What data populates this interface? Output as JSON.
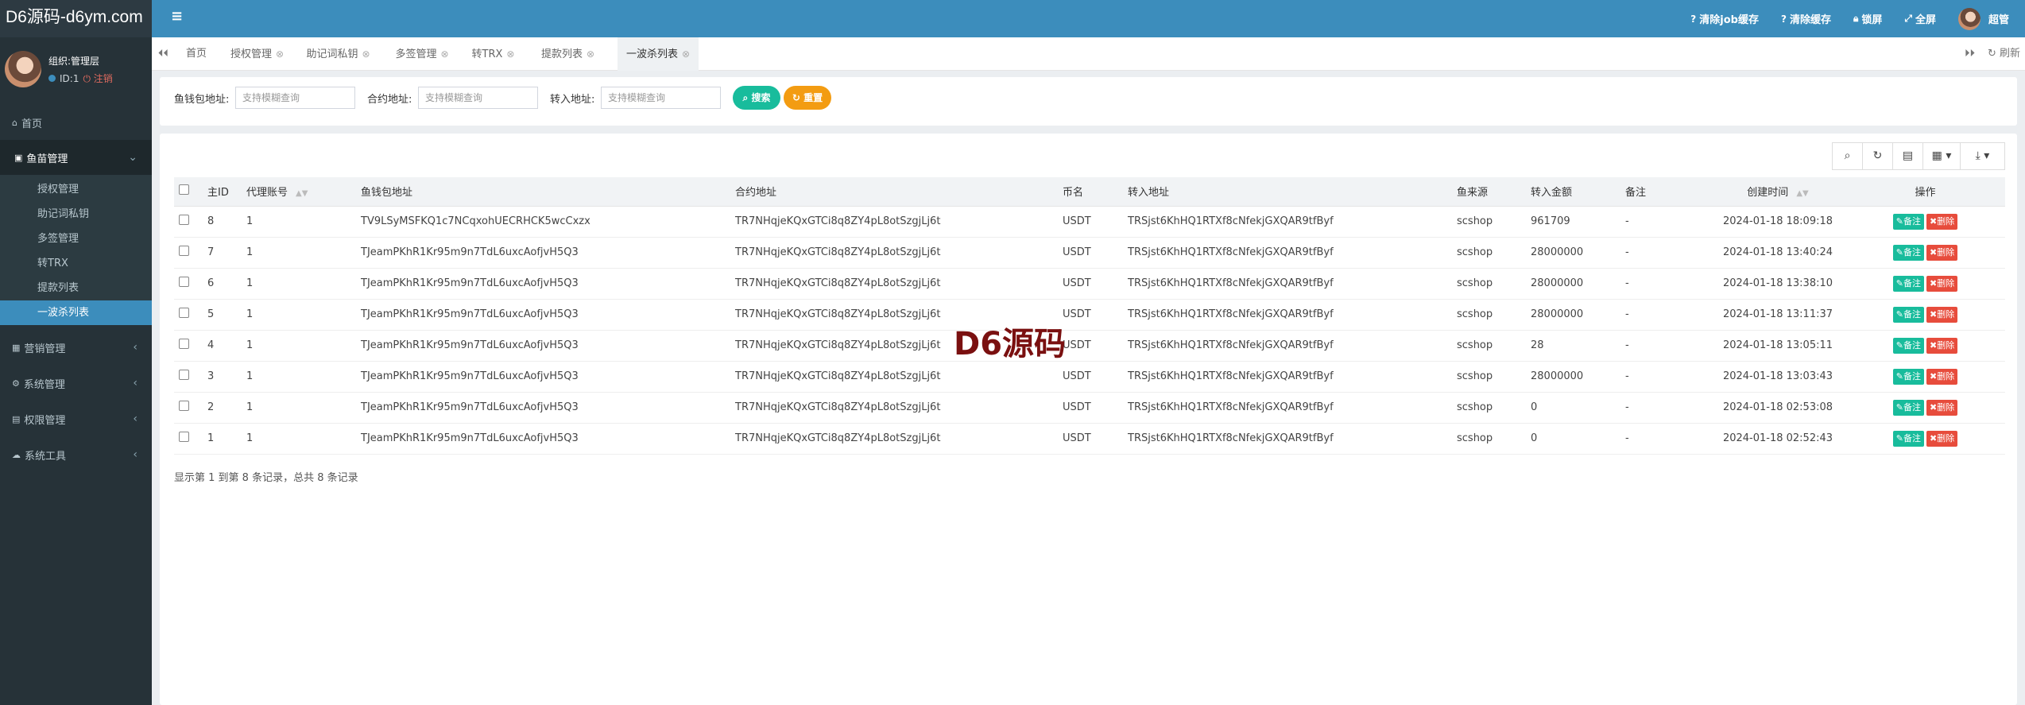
{
  "logo": "D6源码-d6ym.com",
  "user": {
    "name": "组织:管理层",
    "id": "ID:1",
    "logout": "注销"
  },
  "menu": {
    "home": "首页",
    "fish": "鱼苗管理",
    "sub": [
      "授权管理",
      "助记词私钥",
      "多签管理",
      "转TRX",
      "提款列表",
      "一波杀列表"
    ],
    "others": [
      "营销管理",
      "系统管理",
      "权限管理",
      "系统工具"
    ]
  },
  "topbar": {
    "clear_job": "清除job缓存",
    "clear_cache": "清除缓存",
    "lock": "锁屏",
    "fullscreen": "全屏",
    "admin": "超管"
  },
  "tabs": {
    "items": [
      "首页",
      "授权管理",
      "助记词私钥",
      "多签管理",
      "转TRX",
      "提款列表",
      "一波杀列表"
    ],
    "refresh": "刷新"
  },
  "search": {
    "f1_label": "鱼钱包地址:",
    "f1_placeholder": "支持模糊查询",
    "f2_label": "合约地址:",
    "f2_placeholder": "支持模糊查询",
    "f3_label": "转入地址:",
    "f3_placeholder": "支持模糊查询",
    "search_btn": "搜索",
    "reset_btn": "重置"
  },
  "table": {
    "headers": [
      "主ID",
      "代理账号",
      "鱼钱包地址",
      "合约地址",
      "币名",
      "转入地址",
      "鱼来源",
      "转入金额",
      "备注",
      "创建时间",
      "操作"
    ],
    "action_edit": "备注",
    "action_delete": "删除",
    "rows": [
      [
        "8",
        "1",
        "TV9LSyMSFKQ1c7NCqxohUECRHCK5wcCxzx",
        "TR7NHqjeKQxGTCi8q8ZY4pL8otSzgjLj6t",
        "USDT",
        "TRSjst6KhHQ1RTXf8cNfekjGXQAR9tfByf",
        "scshop",
        "961709",
        "-",
        "2024-01-18 18:09:18"
      ],
      [
        "7",
        "1",
        "TJeamPKhR1Kr95m9n7TdL6uxcAofjvH5Q3",
        "TR7NHqjeKQxGTCi8q8ZY4pL8otSzgjLj6t",
        "USDT",
        "TRSjst6KhHQ1RTXf8cNfekjGXQAR9tfByf",
        "scshop",
        "28000000",
        "-",
        "2024-01-18 13:40:24"
      ],
      [
        "6",
        "1",
        "TJeamPKhR1Kr95m9n7TdL6uxcAofjvH5Q3",
        "TR7NHqjeKQxGTCi8q8ZY4pL8otSzgjLj6t",
        "USDT",
        "TRSjst6KhHQ1RTXf8cNfekjGXQAR9tfByf",
        "scshop",
        "28000000",
        "-",
        "2024-01-18 13:38:10"
      ],
      [
        "5",
        "1",
        "TJeamPKhR1Kr95m9n7TdL6uxcAofjvH5Q3",
        "TR7NHqjeKQxGTCi8q8ZY4pL8otSzgjLj6t",
        "USDT",
        "TRSjst6KhHQ1RTXf8cNfekjGXQAR9tfByf",
        "scshop",
        "28000000",
        "-",
        "2024-01-18 13:11:37"
      ],
      [
        "4",
        "1",
        "TJeamPKhR1Kr95m9n7TdL6uxcAofjvH5Q3",
        "TR7NHqjeKQxGTCi8q8ZY4pL8otSzgjLj6t",
        "USDT",
        "TRSjst6KhHQ1RTXf8cNfekjGXQAR9tfByf",
        "scshop",
        "28",
        "-",
        "2024-01-18 13:05:11"
      ],
      [
        "3",
        "1",
        "TJeamPKhR1Kr95m9n7TdL6uxcAofjvH5Q3",
        "TR7NHqjeKQxGTCi8q8ZY4pL8otSzgjLj6t",
        "USDT",
        "TRSjst6KhHQ1RTXf8cNfekjGXQAR9tfByf",
        "scshop",
        "28000000",
        "-",
        "2024-01-18 13:03:43"
      ],
      [
        "2",
        "1",
        "TJeamPKhR1Kr95m9n7TdL6uxcAofjvH5Q3",
        "TR7NHqjeKQxGTCi8q8ZY4pL8otSzgjLj6t",
        "USDT",
        "TRSjst6KhHQ1RTXf8cNfekjGXQAR9tfByf",
        "scshop",
        "0",
        "-",
        "2024-01-18 02:53:08"
      ],
      [
        "1",
        "1",
        "TJeamPKhR1Kr95m9n7TdL6uxcAofjvH5Q3",
        "TR7NHqjeKQxGTCi8q8ZY4pL8otSzgjLj6t",
        "USDT",
        "TRSjst6KhHQ1RTXf8cNfekjGXQAR9tfByf",
        "scshop",
        "0",
        "-",
        "2024-01-18 02:52:43"
      ]
    ]
  },
  "footer": "显示第 1 到第 8 条记录，总共 8 条记录",
  "watermark": "D6源码"
}
